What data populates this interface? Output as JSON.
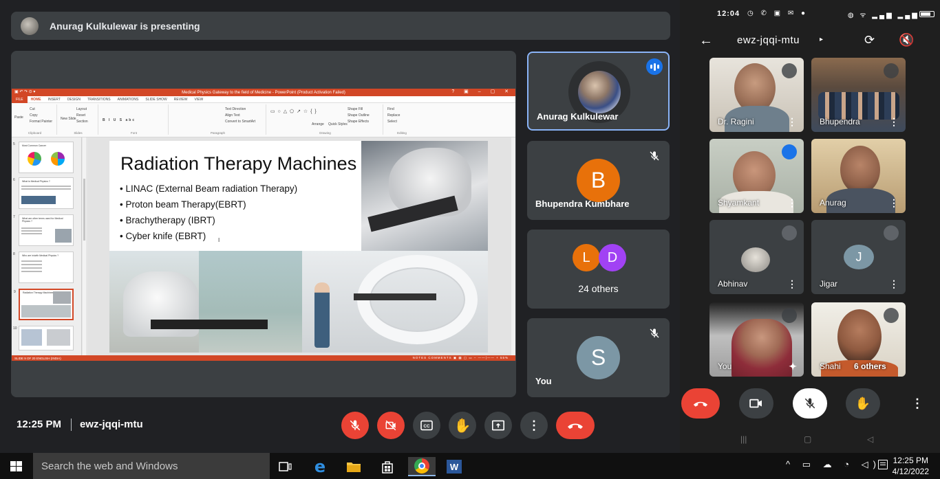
{
  "presenting": {
    "text": "Anurag Kulkulewar is presenting"
  },
  "ppt": {
    "window_title": "Medical Physics Gateway to the field of Medicine - PowerPoint (Product Activation Failed)",
    "tabs": [
      "FILE",
      "HOME",
      "INSERT",
      "DESIGN",
      "TRANSITIONS",
      "ANIMATIONS",
      "SLIDE SHOW",
      "REVIEW",
      "VIEW"
    ],
    "ribbon": {
      "paste": "Paste",
      "cut": "Cut",
      "copy": "Copy",
      "format_painter": "Format Painter",
      "new_slide": "New Slide",
      "layout": "Layout",
      "reset": "Reset",
      "section": "Section",
      "text_direction": "Text Direction",
      "align_text": "Align Text",
      "convert_smartart": "Convert to SmartArt",
      "arrange": "Arrange",
      "quick_styles": "Quick Styles",
      "shape_fill": "Shape Fill",
      "shape_outline": "Shape Outline",
      "shape_effects": "Shape Effects",
      "find": "Find",
      "replace": "Replace",
      "select": "Select",
      "groups": {
        "clipboard": "Clipboard",
        "slides": "Slides",
        "font": "Font",
        "paragraph": "Paragraph",
        "drawing": "Drawing",
        "editing": "Editing"
      }
    },
    "thumbnails": [
      {
        "num": "5",
        "title": "Most Common Cancer"
      },
      {
        "num": "6",
        "title": "What is Medical Physics ?"
      },
      {
        "num": "7",
        "title": "What are other terms used for Medical Physics ?"
      },
      {
        "num": "8",
        "title": "Who are in/with Medical Physics ?"
      },
      {
        "num": "9",
        "title": "Radiation Therapy Machines"
      },
      {
        "num": "10",
        "title": ""
      }
    ],
    "slide": {
      "title": "Radiation Therapy Machines",
      "bullets": [
        "LINAC (External Beam radiation Therapy)",
        "Proton beam Therapy(EBRT)",
        "Brachytherapy (IBRT)",
        "Cyber knife (EBRT)"
      ]
    },
    "status": {
      "left": "SLIDE 9 OF 20    ENGLISH (INDIA)",
      "notes": "NOTES",
      "comments": "COMMENTS",
      "zoom": "55%"
    }
  },
  "tiles": {
    "anurag": {
      "name": "Anurag Kulkulewar"
    },
    "bhupendra": {
      "initial": "B",
      "name": "Bhupendra Kumbhare",
      "color": "#e8710a"
    },
    "others": {
      "initial_1": "L",
      "initial_2": "D",
      "label": "24 others",
      "color_1": "#e8710a",
      "color_2": "#a142f4"
    },
    "you": {
      "initial": "S",
      "name": "You",
      "color": "#7c97a5"
    }
  },
  "meet_bar": {
    "time": "12:25 PM",
    "code": "ewz-jqqi-mtu"
  },
  "phone": {
    "status_time": "12:04",
    "code": "ewz-jqqi-mtu",
    "participants": [
      {
        "name": "Dr. Ragini"
      },
      {
        "name": "Bhupendra"
      },
      {
        "name": "Shyamkant"
      },
      {
        "name": "Anurag"
      },
      {
        "name": "Abhinav"
      },
      {
        "name": "Jigar",
        "initial": "J"
      },
      {
        "name": "You"
      },
      {
        "name": "Shahi",
        "extra": "6 others"
      }
    ]
  },
  "taskbar": {
    "search_placeholder": "Search the web and Windows",
    "time": "12:25 PM",
    "date": "4/12/2022"
  }
}
